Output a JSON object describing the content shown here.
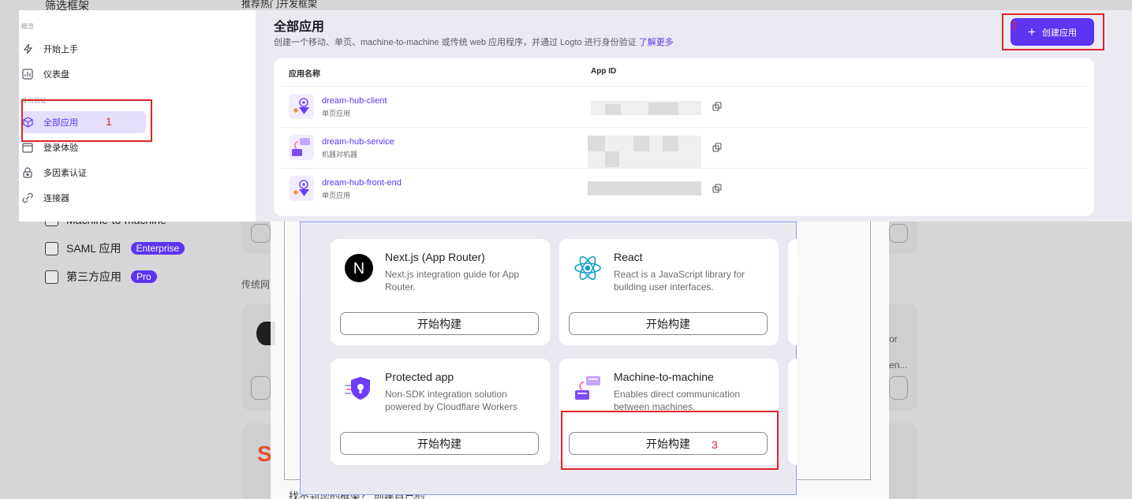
{
  "background": {
    "filter_header": "筛选框架",
    "recommended_header": "推荐热门开发框架",
    "checkboxes": [
      {
        "label": "Machine-to-machine",
        "badge": ""
      },
      {
        "label": "SAML 应用",
        "badge": "Enterprise"
      },
      {
        "label": "第三方应用",
        "badge": "Pro"
      }
    ],
    "traditional_header": "传统网",
    "footer_text": "找不到您的框架？ 创建自己的",
    "card_fragments": [
      "or",
      "en..."
    ]
  },
  "dialog": {
    "frameworks": [
      {
        "title": "Next.js (App Router)",
        "desc": "Next.js integration guide for App Router.",
        "button": "开始构建",
        "icon": "nextjs-icon"
      },
      {
        "title": "React",
        "desc": "React is a JavaScript library for building user interfaces.",
        "button": "开始构建",
        "icon": "react-icon"
      },
      {
        "title": "Protected app",
        "desc": "Non-SDK integration solution powered by Cloudflare Workers",
        "button": "开始构建",
        "icon": "protected-app-icon"
      },
      {
        "title": "Machine-to-machine",
        "desc": "Enables direct communication between machines.",
        "button": "开始构建",
        "icon": "m2m-icon"
      }
    ]
  },
  "sidebar": {
    "section_overview": "概览",
    "section_identity": "身份验证",
    "items": [
      {
        "label": "开始上手",
        "icon": "lightning-icon"
      },
      {
        "label": "仪表盘",
        "icon": "chart-icon"
      },
      {
        "label": "全部应用",
        "icon": "cube-icon",
        "active": true
      },
      {
        "label": "登录体验",
        "icon": "window-icon"
      },
      {
        "label": "多因素认证",
        "icon": "lock-icon"
      },
      {
        "label": "连接器",
        "icon": "connector-icon"
      }
    ]
  },
  "header": {
    "title": "全部应用",
    "subtitle": "创建一个移动、单页、machine-to-machine 或传统 web 应用程序，并通过 Logto 进行身份验证",
    "learn_more": "了解更多",
    "create_button": "创建应用"
  },
  "table": {
    "columns": [
      "应用名称",
      "App ID"
    ],
    "rows": [
      {
        "name": "dream-hub-client",
        "type": "单页应用"
      },
      {
        "name": "dream-hub-service",
        "type": "机器对机器"
      },
      {
        "name": "dream-hub-front-end",
        "type": "单页应用"
      }
    ]
  },
  "annotations": [
    "1",
    "2",
    "3"
  ],
  "colors": {
    "accent": "#5d34f2",
    "annotation": "#e0242b"
  }
}
